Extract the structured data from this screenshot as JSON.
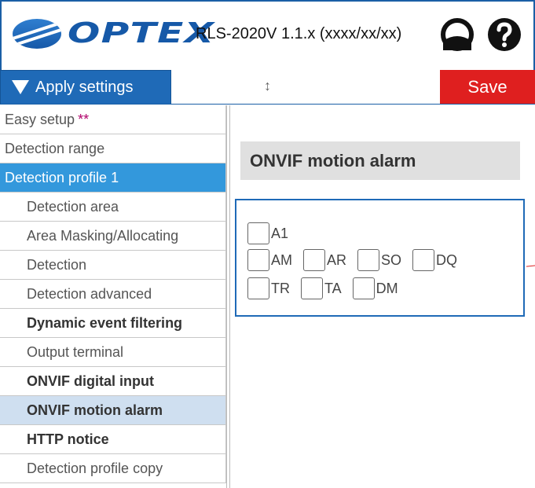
{
  "header": {
    "logo_text": "OPTEX",
    "version": "RLS-2020V 1.1.x (xxxx/xx/xx)",
    "user_icon": "user-icon",
    "help_icon": "help-icon",
    "brand_color": "#1659a8"
  },
  "toolbar": {
    "apply_label": "Apply settings",
    "resize_glyph": "↕",
    "save_label": "Save",
    "save_color": "#df1f1f"
  },
  "sidebar": {
    "items": [
      {
        "label": "Easy setup",
        "stars": "**"
      },
      {
        "label": "Detection range"
      },
      {
        "label": "Detection profile 1"
      },
      {
        "label": "Detection area"
      },
      {
        "label": "Area Masking/Allocating"
      },
      {
        "label": "Detection"
      },
      {
        "label": "Detection advanced"
      },
      {
        "label": "Dynamic event filtering"
      },
      {
        "label": "Output terminal"
      },
      {
        "label": "ONVIF digital input"
      },
      {
        "label": "ONVIF motion alarm"
      },
      {
        "label": "HTTP notice"
      },
      {
        "label": "Detection profile copy"
      }
    ]
  },
  "main": {
    "title": "ONVIF motion alarm",
    "checkboxes": {
      "a1": "A1",
      "am": "AM",
      "ar": "AR",
      "so": "SO",
      "dq": "DQ",
      "tr": "TR",
      "ta": "TA",
      "dm": "DM"
    }
  }
}
